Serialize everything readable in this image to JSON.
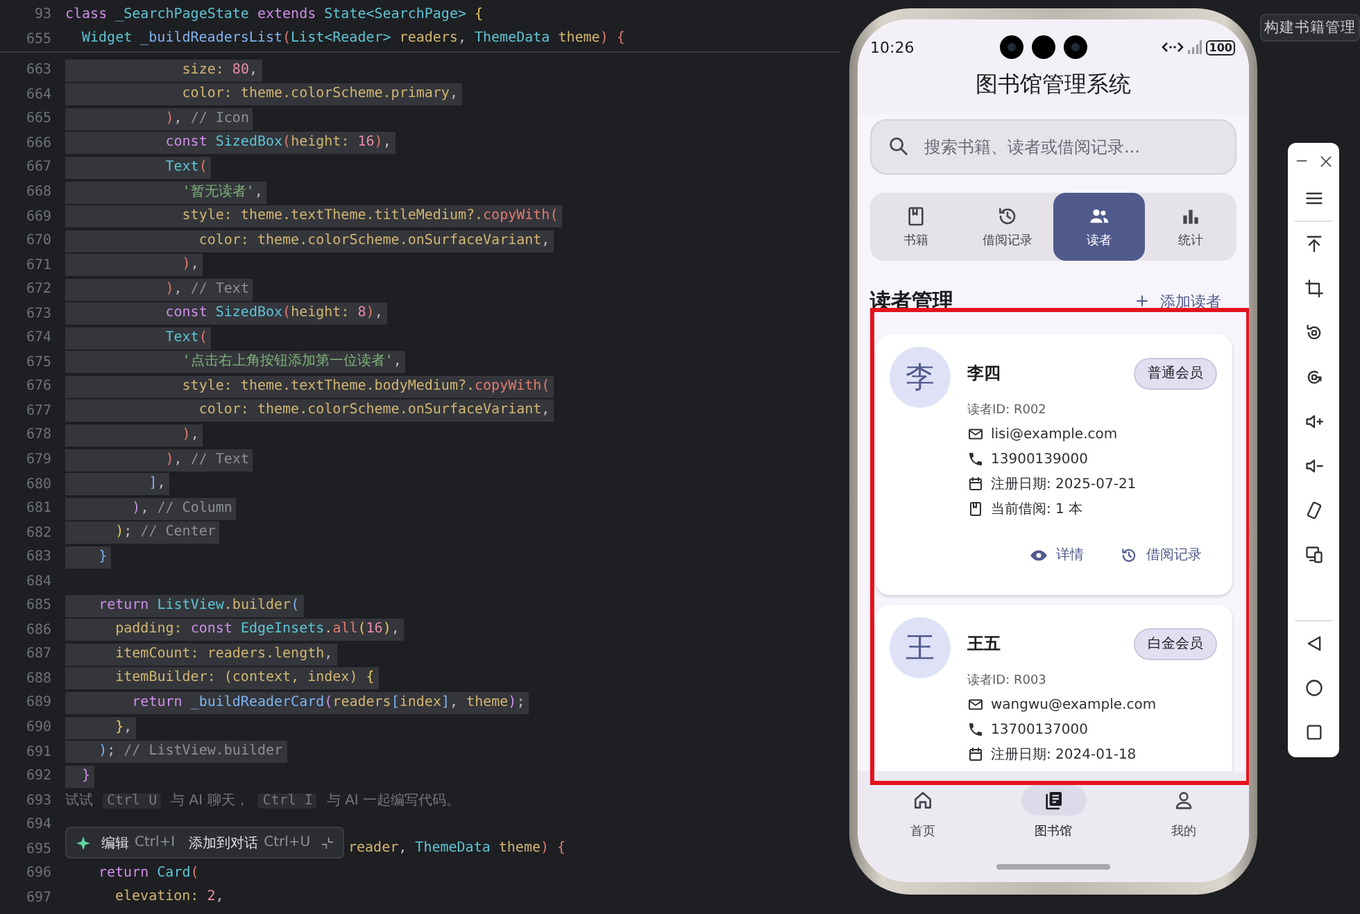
{
  "editor": {
    "sticky_lines": [
      {
        "number": "93",
        "tokens": [
          {
            "kind": "kw",
            "text": "class "
          },
          {
            "kind": "type",
            "text": "_SearchPageState"
          },
          {
            "kind": "kw",
            "text": " extends "
          },
          {
            "kind": "type",
            "text": "State<SearchPage>"
          },
          {
            "kind": "brace",
            "text": " {"
          }
        ]
      },
      {
        "number": "655",
        "tokens": [
          {
            "kind": "type",
            "text": "  Widget"
          },
          {
            "kind": "fn",
            "text": " _buildReadersList"
          },
          {
            "kind": "call",
            "text": "("
          },
          {
            "kind": "type",
            "text": "List<Reader>"
          },
          {
            "kind": "prop",
            "text": " readers"
          },
          {
            "kind": "punc",
            "text": ", "
          },
          {
            "kind": "type",
            "text": "ThemeData"
          },
          {
            "kind": "prop",
            "text": " theme"
          },
          {
            "kind": "call",
            "text": ") {"
          }
        ]
      }
    ],
    "lines": [
      {
        "number": "663",
        "selected": true,
        "tokens": [
          {
            "kind": "prop",
            "text": "              size: "
          },
          {
            "kind": "num",
            "text": "80"
          },
          {
            "kind": "punc",
            "text": ","
          }
        ]
      },
      {
        "number": "664",
        "selected": true,
        "tokens": [
          {
            "kind": "prop",
            "text": "              color: theme.colorScheme.primary"
          },
          {
            "kind": "punc",
            "text": ","
          }
        ]
      },
      {
        "number": "665",
        "selected": true,
        "tokens": [
          {
            "kind": "call",
            "text": "            )"
          },
          {
            "kind": "punc",
            "text": ", "
          },
          {
            "kind": "cmt",
            "text": "// Icon"
          }
        ]
      },
      {
        "number": "666",
        "selected": true,
        "tokens": [
          {
            "kind": "kw",
            "text": "            const "
          },
          {
            "kind": "type",
            "text": "SizedBox"
          },
          {
            "kind": "call",
            "text": "("
          },
          {
            "kind": "prop",
            "text": "height: "
          },
          {
            "kind": "num",
            "text": "16"
          },
          {
            "kind": "call",
            "text": ")"
          },
          {
            "kind": "punc",
            "text": ","
          }
        ]
      },
      {
        "number": "667",
        "selected": true,
        "tokens": [
          {
            "kind": "type",
            "text": "            Text"
          },
          {
            "kind": "call",
            "text": "("
          }
        ]
      },
      {
        "number": "668",
        "selected": true,
        "tokens": [
          {
            "kind": "str",
            "text": "              '暂无读者'"
          },
          {
            "kind": "punc",
            "text": ","
          }
        ]
      },
      {
        "number": "669",
        "selected": true,
        "tokens": [
          {
            "kind": "prop",
            "text": "              style: theme.textTheme.titleMedium?."
          },
          {
            "kind": "call",
            "text": "copyWith("
          }
        ]
      },
      {
        "number": "670",
        "selected": true,
        "tokens": [
          {
            "kind": "prop",
            "text": "                color: theme.colorScheme.onSurfaceVariant"
          },
          {
            "kind": "punc",
            "text": ","
          }
        ]
      },
      {
        "number": "671",
        "selected": true,
        "tokens": [
          {
            "kind": "call",
            "text": "              )"
          },
          {
            "kind": "punc",
            "text": ","
          }
        ]
      },
      {
        "number": "672",
        "selected": true,
        "tokens": [
          {
            "kind": "call",
            "text": "            )"
          },
          {
            "kind": "punc",
            "text": ", "
          },
          {
            "kind": "cmt",
            "text": "// Text"
          }
        ]
      },
      {
        "number": "673",
        "selected": true,
        "tokens": [
          {
            "kind": "kw",
            "text": "            const "
          },
          {
            "kind": "type",
            "text": "SizedBox"
          },
          {
            "kind": "call",
            "text": "("
          },
          {
            "kind": "prop",
            "text": "height: "
          },
          {
            "kind": "num",
            "text": "8"
          },
          {
            "kind": "call",
            "text": ")"
          },
          {
            "kind": "punc",
            "text": ","
          }
        ]
      },
      {
        "number": "674",
        "selected": true,
        "tokens": [
          {
            "kind": "type",
            "text": "            Text"
          },
          {
            "kind": "call",
            "text": "("
          }
        ]
      },
      {
        "number": "675",
        "selected": true,
        "tokens": [
          {
            "kind": "str",
            "text": "              '点击右上角按钮添加第一位读者'"
          },
          {
            "kind": "punc",
            "text": ","
          }
        ]
      },
      {
        "number": "676",
        "selected": true,
        "tokens": [
          {
            "kind": "prop",
            "text": "              style: theme.textTheme.bodyMedium?."
          },
          {
            "kind": "call",
            "text": "copyWith("
          }
        ]
      },
      {
        "number": "677",
        "selected": true,
        "tokens": [
          {
            "kind": "prop",
            "text": "                color: theme.colorScheme.onSurfaceVariant"
          },
          {
            "kind": "punc",
            "text": ","
          }
        ]
      },
      {
        "number": "678",
        "selected": true,
        "tokens": [
          {
            "kind": "call",
            "text": "              )"
          },
          {
            "kind": "punc",
            "text": ","
          }
        ]
      },
      {
        "number": "679",
        "selected": true,
        "tokens": [
          {
            "kind": "call",
            "text": "            )"
          },
          {
            "kind": "punc",
            "text": ", "
          },
          {
            "kind": "cmt",
            "text": "// Text"
          }
        ]
      },
      {
        "number": "680",
        "selected": true,
        "tokens": [
          {
            "kind": "fn",
            "text": "          ]"
          },
          {
            "kind": "punc",
            "text": ","
          }
        ]
      },
      {
        "number": "681",
        "selected": true,
        "tokens": [
          {
            "kind": "kw",
            "text": "        )"
          },
          {
            "kind": "punc",
            "text": ", "
          },
          {
            "kind": "cmt",
            "text": "// Column"
          }
        ]
      },
      {
        "number": "682",
        "selected": true,
        "tokens": [
          {
            "kind": "brace",
            "text": "      )"
          },
          {
            "kind": "punc",
            "text": "; "
          },
          {
            "kind": "cmt",
            "text": "// Center"
          }
        ]
      },
      {
        "number": "683",
        "selected": true,
        "tokens": [
          {
            "kind": "fn",
            "text": "    }"
          }
        ]
      },
      {
        "number": "684"
      },
      {
        "number": "685",
        "selected": true,
        "tokens": [
          {
            "kind": "kw",
            "text": "    return "
          },
          {
            "kind": "type",
            "text": "ListView"
          },
          {
            "kind": "prop",
            "text": ".builder"
          },
          {
            "kind": "fn",
            "text": "("
          }
        ]
      },
      {
        "number": "686",
        "selected": true,
        "tokens": [
          {
            "kind": "prop",
            "text": "      padding: "
          },
          {
            "kind": "kw",
            "text": "const "
          },
          {
            "kind": "type",
            "text": "EdgeInsets"
          },
          {
            "kind": "prop",
            "text": "."
          },
          {
            "kind": "call",
            "text": "all"
          },
          {
            "kind": "brace",
            "text": "("
          },
          {
            "kind": "num",
            "text": "16"
          },
          {
            "kind": "brace",
            "text": ")"
          },
          {
            "kind": "punc",
            "text": ","
          }
        ]
      },
      {
        "number": "687",
        "selected": true,
        "tokens": [
          {
            "kind": "prop",
            "text": "      itemCount: readers.length"
          },
          {
            "kind": "punc",
            "text": ","
          }
        ]
      },
      {
        "number": "688",
        "selected": true,
        "tokens": [
          {
            "kind": "prop",
            "text": "      itemBuilder: (context, index) "
          },
          {
            "kind": "brace",
            "text": "{"
          }
        ]
      },
      {
        "number": "689",
        "selected": true,
        "tokens": [
          {
            "kind": "kw",
            "text": "        return "
          },
          {
            "kind": "fn",
            "text": "_buildReaderCard"
          },
          {
            "kind": "kw",
            "text": "("
          },
          {
            "kind": "prop",
            "text": "readers"
          },
          {
            "kind": "fn",
            "text": "["
          },
          {
            "kind": "prop",
            "text": "index"
          },
          {
            "kind": "fn",
            "text": "]"
          },
          {
            "kind": "punc",
            "text": ", "
          },
          {
            "kind": "prop",
            "text": "theme"
          },
          {
            "kind": "kw",
            "text": ")"
          },
          {
            "kind": "punc",
            "text": ";"
          }
        ]
      },
      {
        "number": "690",
        "selected": true,
        "tokens": [
          {
            "kind": "brace",
            "text": "      }"
          },
          {
            "kind": "punc",
            "text": ","
          }
        ]
      },
      {
        "number": "691",
        "selected": true,
        "tokens": [
          {
            "kind": "fn",
            "text": "    )"
          },
          {
            "kind": "punc",
            "text": "; "
          },
          {
            "kind": "cmt",
            "text": "// ListView.builder"
          }
        ]
      },
      {
        "number": "692",
        "selected": true,
        "tokens": [
          {
            "kind": "kw",
            "text": "  }"
          }
        ]
      },
      {
        "number": "693",
        "tokens": [
          {
            "kind": "ghost",
            "text": "试试"
          },
          {
            "kind": "key",
            "text": "Ctrl U"
          },
          {
            "kind": "ghost",
            "text": "与 AI 聊天，"
          },
          {
            "kind": "key",
            "text": "Ctrl I"
          },
          {
            "kind": "ghost",
            "text": "与 AI 一起编写代码。"
          }
        ]
      },
      {
        "number": "694"
      },
      {
        "number": "695",
        "selected": false,
        "tokens": [
          {
            "kind": "prop",
            "text": "                                  reader"
          },
          {
            "kind": "punc",
            "text": ", "
          },
          {
            "kind": "type",
            "text": "ThemeData"
          },
          {
            "kind": "prop",
            "text": " theme"
          },
          {
            "kind": "call",
            "text": ") {"
          }
        ]
      },
      {
        "number": "696",
        "selected": false,
        "tokens": [
          {
            "kind": "kw",
            "text": "    return "
          },
          {
            "kind": "type",
            "text": "Card"
          },
          {
            "kind": "call",
            "text": "("
          }
        ]
      },
      {
        "number": "697",
        "selected": false,
        "tokens": [
          {
            "kind": "prop",
            "text": "      elevation: "
          },
          {
            "kind": "num",
            "text": "2"
          },
          {
            "kind": "punc",
            "text": ","
          }
        ]
      }
    ],
    "inline_actions": [
      {
        "label": "编辑",
        "shortcut": "Ctrl+I"
      },
      {
        "label": "添加到对话",
        "shortcut": "Ctrl+U"
      }
    ]
  },
  "phone": {
    "status_bar": {
      "time": "10:26",
      "battery_label": "100"
    },
    "title": "图书馆管理系统",
    "search": {
      "placeholder": "搜索书籍、读者或借阅记录..."
    },
    "tabs": [
      {
        "label": "书籍",
        "selected": false
      },
      {
        "label": "借阅记录",
        "selected": false
      },
      {
        "label": "读者",
        "selected": true
      },
      {
        "label": "统计",
        "selected": false
      }
    ],
    "section": {
      "title": "读者管理",
      "action": "添加读者"
    },
    "readers": [
      {
        "avatar": "李",
        "name": "李四",
        "membership": "普通会员",
        "reader_id": "读者ID: R002",
        "details": [
          {
            "kind": "email",
            "text": "lisi@example.com"
          },
          {
            "kind": "phone",
            "text": "13900139000"
          },
          {
            "kind": "date",
            "text": "注册日期: 2025-07-21"
          },
          {
            "kind": "borrowed",
            "text": "当前借阅: 1 本"
          }
        ],
        "actions": [
          "详情",
          "借阅记录"
        ]
      },
      {
        "avatar": "王",
        "name": "王五",
        "membership": "白金会员",
        "reader_id": "读者ID: R003",
        "details": [
          {
            "kind": "email",
            "text": "wangwu@example.com"
          },
          {
            "kind": "phone",
            "text": "13700137000"
          },
          {
            "kind": "date",
            "text": "注册日期: 2024-01-18"
          }
        ]
      }
    ],
    "bottom_nav": [
      {
        "label": "首页",
        "selected": false
      },
      {
        "label": "图书馆",
        "selected": true
      },
      {
        "label": "我的",
        "selected": false
      }
    ]
  },
  "emulator": {
    "window_tab": "构建书籍管理"
  }
}
